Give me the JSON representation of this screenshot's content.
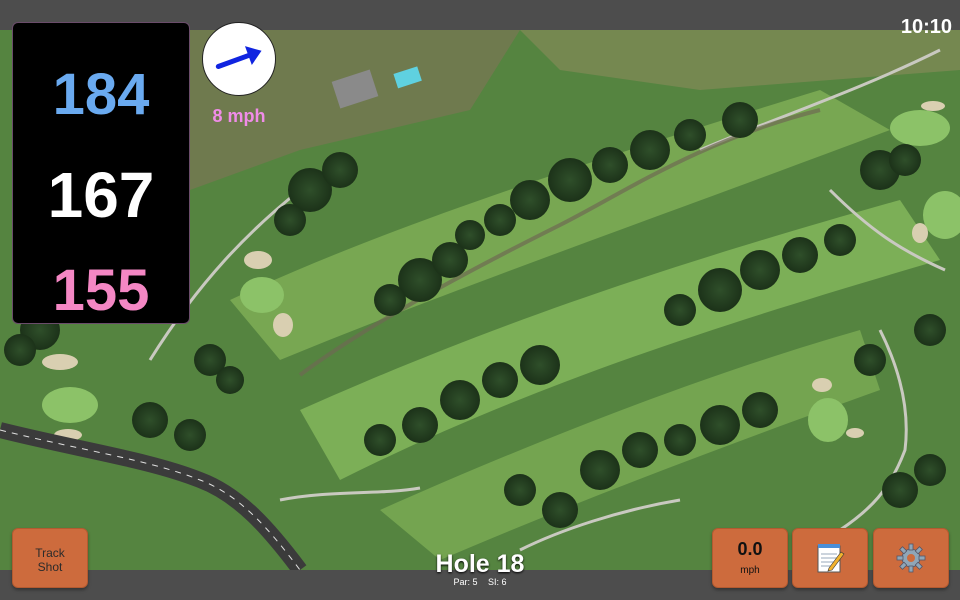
{
  "status": {
    "time": "10:10"
  },
  "yardage": {
    "back": "184",
    "middle": "167",
    "front": "155"
  },
  "wind": {
    "speed": "8 mph",
    "direction_icon": "arrow-icon"
  },
  "buttons": {
    "track_shot_line1": "Track",
    "track_shot_line2": "Shot",
    "speed_value": "0.0",
    "speed_unit": "mph",
    "notes_icon": "notepad-icon",
    "settings_icon": "gear-icon"
  },
  "hole": {
    "title": "Hole 18",
    "par": "Par: 5",
    "si": "SI: 6"
  },
  "colors": {
    "button": "#cd6b3d",
    "back_yardage": "#6aaaf0",
    "middle_yardage": "#ffffff",
    "front_yardage": "#f487c4",
    "wind_text": "#f08ce8"
  }
}
